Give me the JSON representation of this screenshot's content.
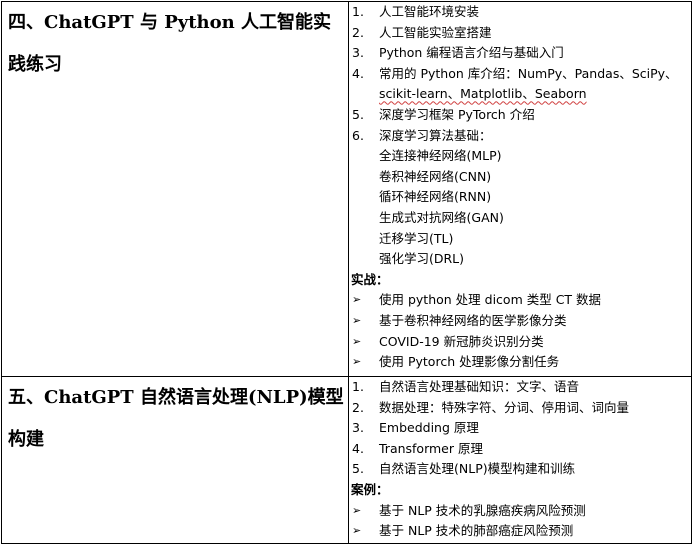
{
  "sections": [
    {
      "title": "四、ChatGPT 与 Python 人工智能实践练习",
      "items": [
        {
          "num": "1.",
          "text": "人工智能环境安装"
        },
        {
          "num": "2.",
          "text": "人工智能实验室搭建"
        },
        {
          "num": "3.",
          "text": "Python 编程语言介绍与基础入门"
        },
        {
          "num": "4.",
          "text": "常用的 Python 库介绍：NumPy、Pandas、SciPy、"
        },
        {
          "num": "",
          "text": "scikit-learn、Matplotlib、Seaborn"
        },
        {
          "num": "5.",
          "text": "深度学习框架 PyTorch 介绍"
        },
        {
          "num": "6.",
          "text": "深度学习算法基础："
        },
        {
          "num": "",
          "text": "全连接神经网络(MLP)"
        },
        {
          "num": "",
          "text": "卷积神经网络(CNN)"
        },
        {
          "num": "",
          "text": "循环神经网络(RNN)"
        },
        {
          "num": "",
          "text": "生成式对抗网络(GAN)"
        },
        {
          "num": "",
          "text": "迁移学习(TL)"
        },
        {
          "num": "",
          "text": "强化学习(DRL)"
        }
      ],
      "subheading": "实战：",
      "bullets": [
        "使用 python 处理 dicom 类型 CT 数据",
        "基于卷积神经网络的医学影像分类",
        "COVID-19 新冠肺炎识别分类",
        "使用 Pytorch 处理影像分割任务"
      ]
    },
    {
      "title": "五、ChatGPT 自然语言处理(NLP)模型构建",
      "items": [
        {
          "num": "1.",
          "text": "自然语言处理基础知识：文字、语音"
        },
        {
          "num": "2.",
          "text": "数据处理：特殊字符、分词、停用词、词向量"
        },
        {
          "num": "3.",
          "text": "Embedding 原理"
        },
        {
          "num": "4.",
          "text": "Transformer 原理"
        },
        {
          "num": "5.",
          "text": "自然语言处理(NLP)模型构建和训练"
        }
      ],
      "subheading": "案例：",
      "bullets": [
        "基于 NLP 技术的乳腺癌疾病风险预测",
        "基于 NLP 技术的肺部癌症风险预测"
      ]
    }
  ],
  "icons": {
    "bullet": "arrowhead-bullet-icon"
  }
}
